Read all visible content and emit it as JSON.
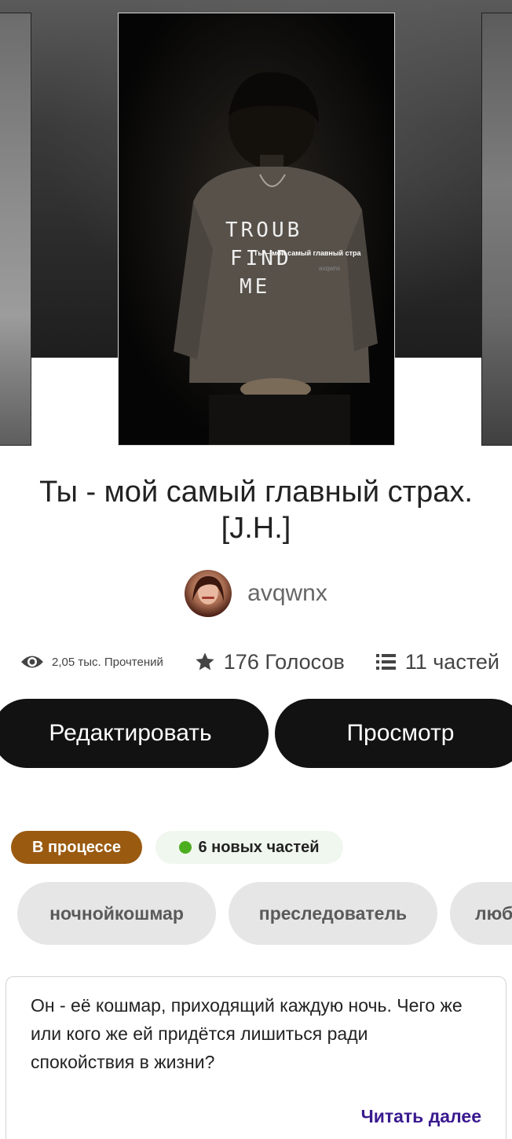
{
  "story": {
    "title": "Ты - мой самый главный страх. [J.H.]",
    "cover_overlay_title": "Ты – мой самый главный стра",
    "cover_overlay_author": "avqwnx",
    "cover_shirt_text": [
      "TROUB",
      "FIND",
      "ME"
    ]
  },
  "author": {
    "name": "avqwnx"
  },
  "stats": {
    "reads": "2,05 тыс. Прочтений",
    "votes": "176 Голосов",
    "parts": "11 частей"
  },
  "actions": {
    "edit_label": "Редактировать",
    "view_label": "Просмотр"
  },
  "status": {
    "progress_label": "В процессе",
    "new_parts_label": "6 новых частей",
    "new_dot_color": "#4cae1f",
    "progress_color": "#9a5a10"
  },
  "tags": [
    "ночнойкошмар",
    "преследователь",
    "люб"
  ],
  "description": {
    "text": "Он - её кошмар, приходящий каждую ночь. Чего же или кого же ей придётся лишиться ради спокойствия в жизни?",
    "read_more_label": "Читать далее",
    "read_more_color": "#3a1a8f"
  },
  "icons": {
    "reads": "eye-icon",
    "votes": "star-icon",
    "parts": "list-icon"
  }
}
